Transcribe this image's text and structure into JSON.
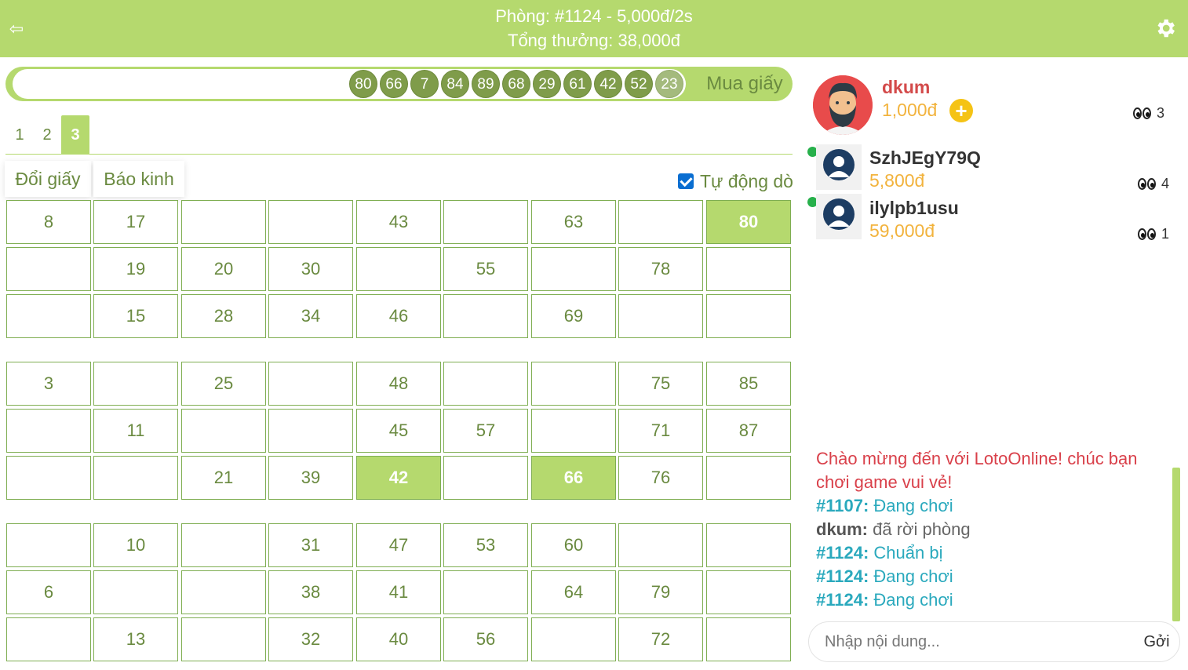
{
  "header": {
    "title": "Phòng: #1124 - 5,000đ/2s",
    "subtitle": "Tổng thưởng: 38,000đ",
    "back_icon": "back-arrow-icon",
    "settings_icon": "gear-icon"
  },
  "ball_bar": {
    "balls": [
      "80",
      "66",
      "7",
      "84",
      "89",
      "68",
      "29",
      "61",
      "42",
      "52",
      "23"
    ],
    "buy_label": "Mua giấy"
  },
  "tickets": {
    "tabs": [
      "1",
      "2",
      "3"
    ],
    "active_tab": "3"
  },
  "actions": {
    "change_label": "Đổi giấy",
    "report_label": "Báo kinh",
    "auto_label": "Tự động dò",
    "auto_checked": true
  },
  "grid": {
    "rows": [
      [
        "8",
        "17",
        "",
        "",
        "43",
        "",
        "63",
        "",
        "80"
      ],
      [
        "",
        "19",
        "20",
        "30",
        "",
        "55",
        "",
        "78",
        ""
      ],
      [
        "",
        "15",
        "28",
        "34",
        "46",
        "",
        "69",
        "",
        ""
      ],
      [
        "3",
        "",
        "25",
        "",
        "48",
        "",
        "",
        "75",
        "85"
      ],
      [
        "",
        "11",
        "",
        "",
        "45",
        "57",
        "",
        "71",
        "87"
      ],
      [
        "",
        "",
        "21",
        "39",
        "42",
        "",
        "66",
        "76",
        ""
      ],
      [
        "",
        "10",
        "",
        "31",
        "47",
        "53",
        "60",
        "",
        ""
      ],
      [
        "6",
        "",
        "",
        "38",
        "41",
        "",
        "64",
        "79",
        ""
      ],
      [
        "",
        "13",
        "",
        "32",
        "40",
        "56",
        "",
        "72",
        ""
      ]
    ],
    "marked": [
      "80",
      "42",
      "66"
    ]
  },
  "players": {
    "main": {
      "name": "dkum",
      "money": "1,000đ",
      "watchers": "3",
      "add_icon": "plus-icon"
    },
    "others": [
      {
        "name": "SzhJEgY79Q",
        "money": "5,800đ",
        "watchers": "4"
      },
      {
        "name": "ilylpb1usu",
        "money": "59,000đ",
        "watchers": "1"
      }
    ]
  },
  "chat": {
    "welcome": "Chào mừng đến với LotoOnline! chúc bạn chơi game vui vẻ!",
    "messages": [
      {
        "who": "#1107:",
        "text": "Đang chơi",
        "kind": "room"
      },
      {
        "who": "dkum:",
        "text": "đã rời phòng",
        "kind": "user"
      },
      {
        "who": "#1124:",
        "text": "Chuẩn bị",
        "kind": "room"
      },
      {
        "who": "#1124:",
        "text": "Đang chơi",
        "kind": "room"
      },
      {
        "who": "#1124:",
        "text": "Đang chơi",
        "kind": "room"
      }
    ],
    "input_placeholder": "Nhập nội dung...",
    "send_label": "Gởi"
  },
  "colors": {
    "accent": "#b5d96e",
    "ball": "#7f9c4a",
    "text_green": "#6a8a40",
    "money": "#f2b33d",
    "room_tag": "#2aa9bd",
    "welcome": "#d9404a"
  }
}
